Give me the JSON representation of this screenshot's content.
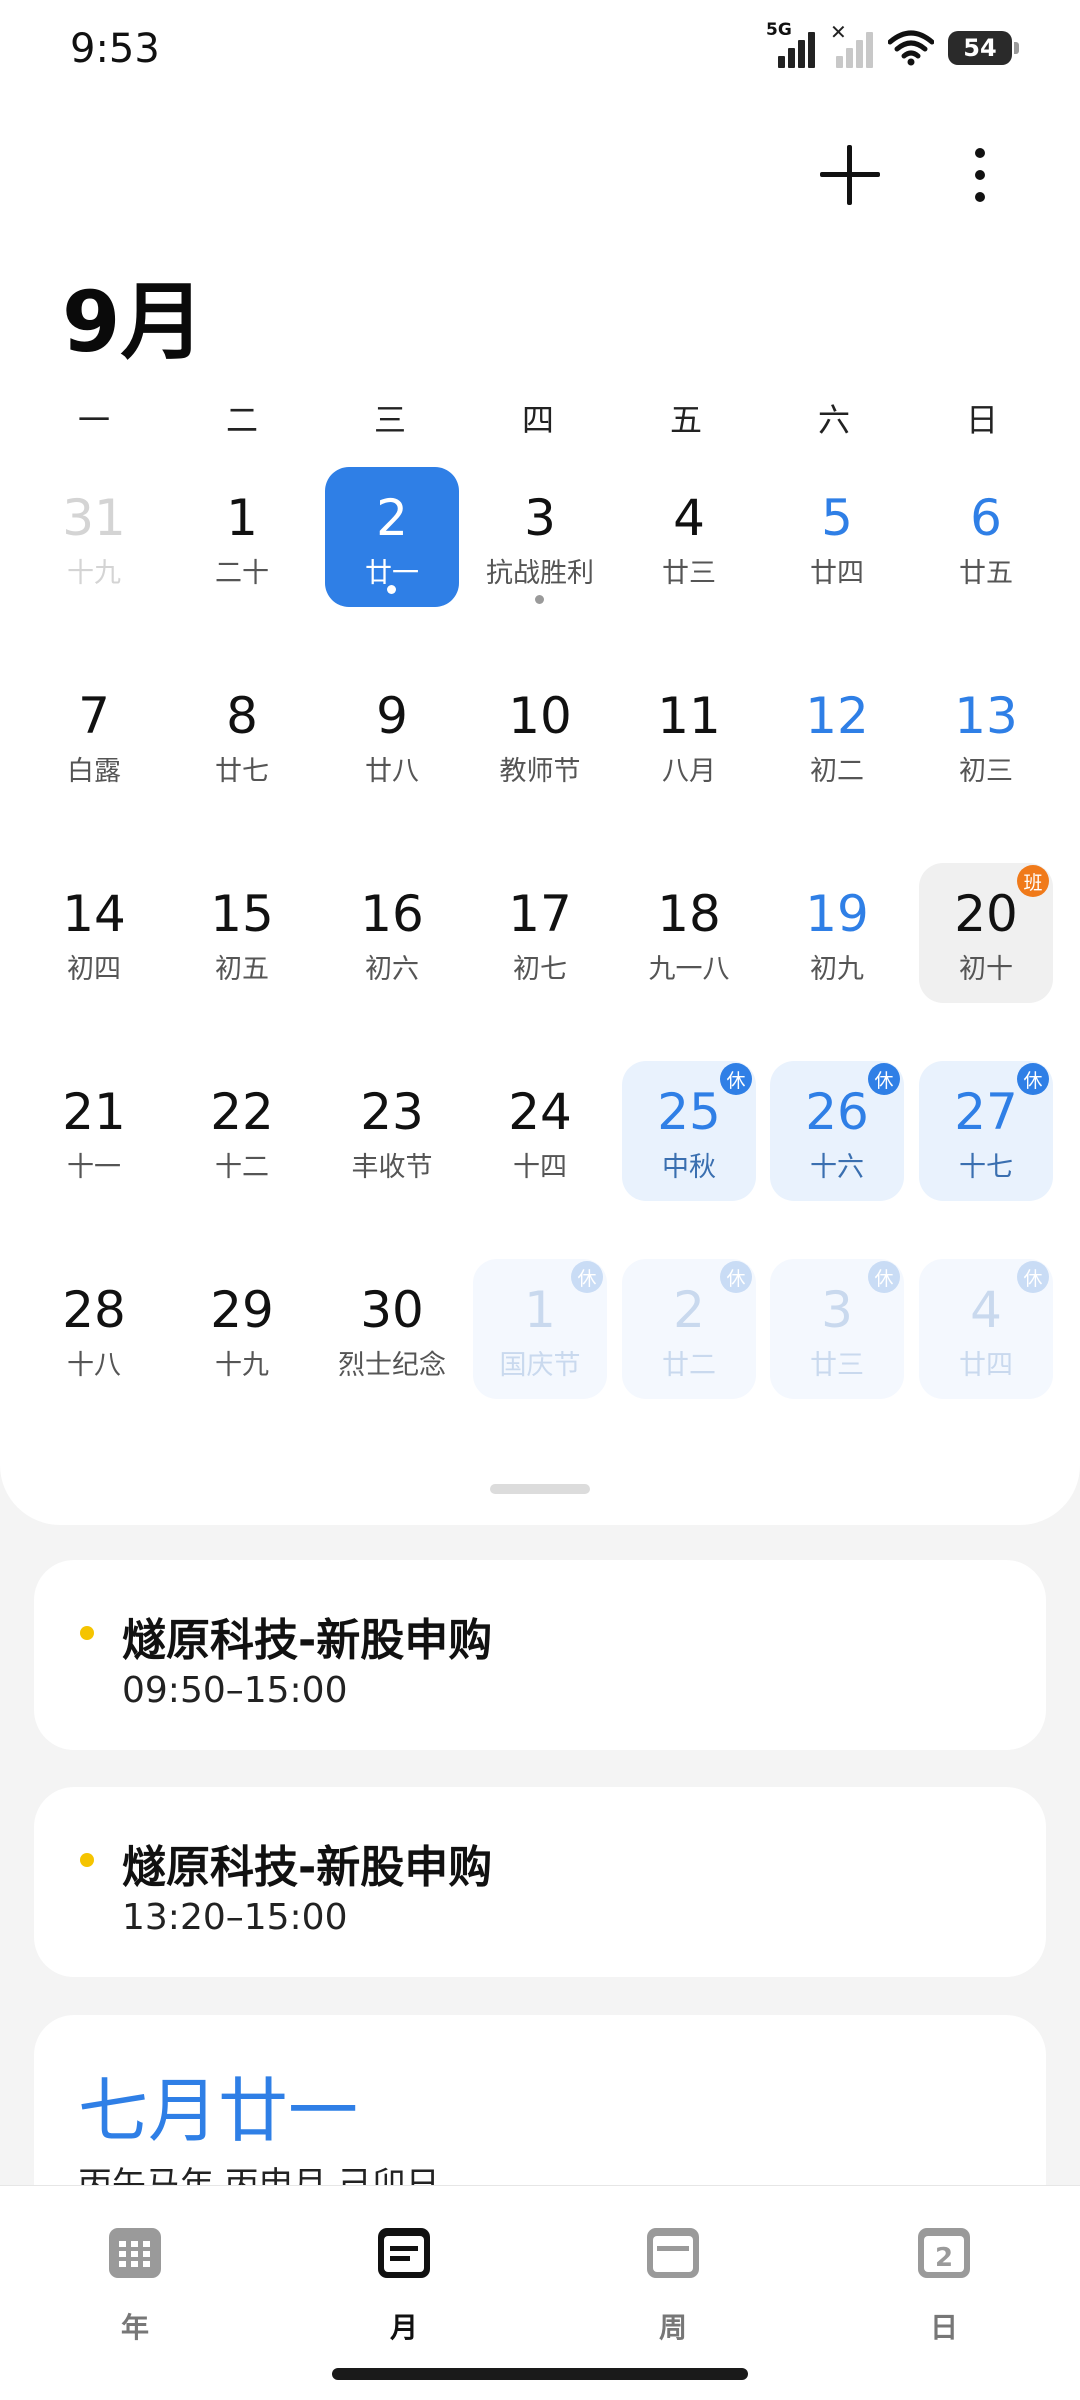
{
  "status_bar": {
    "time": "9:53",
    "network_label": "5G",
    "battery": "54"
  },
  "header": {
    "month_title": "9月",
    "add_icon": "plus-icon",
    "more_icon": "more-vertical-icon"
  },
  "weekdays": [
    "一",
    "二",
    "三",
    "四",
    "五",
    "六",
    "日"
  ],
  "days": [
    {
      "num": "31",
      "lunar": "十九",
      "faded": true
    },
    {
      "num": "1",
      "lunar": "二十"
    },
    {
      "num": "2",
      "lunar": "廿一",
      "today": true,
      "has_event": true
    },
    {
      "num": "3",
      "lunar": "抗战胜利",
      "has_event": true
    },
    {
      "num": "4",
      "lunar": "廿三"
    },
    {
      "num": "5",
      "lunar": "廿四",
      "weekend": true
    },
    {
      "num": "6",
      "lunar": "廿五",
      "weekend": true
    },
    {
      "num": "7",
      "lunar": "白露"
    },
    {
      "num": "8",
      "lunar": "廿七"
    },
    {
      "num": "9",
      "lunar": "廿八"
    },
    {
      "num": "10",
      "lunar": "教师节"
    },
    {
      "num": "11",
      "lunar": "八月"
    },
    {
      "num": "12",
      "lunar": "初二",
      "weekend": true
    },
    {
      "num": "13",
      "lunar": "初三",
      "weekend": true
    },
    {
      "num": "14",
      "lunar": "初四"
    },
    {
      "num": "15",
      "lunar": "初五"
    },
    {
      "num": "16",
      "lunar": "初六"
    },
    {
      "num": "17",
      "lunar": "初七"
    },
    {
      "num": "18",
      "lunar": "九一八"
    },
    {
      "num": "19",
      "lunar": "初九",
      "weekend": true
    },
    {
      "num": "20",
      "lunar": "初十",
      "workday": true,
      "badge": "班"
    },
    {
      "num": "21",
      "lunar": "十一"
    },
    {
      "num": "22",
      "lunar": "十二"
    },
    {
      "num": "23",
      "lunar": "丰收节"
    },
    {
      "num": "24",
      "lunar": "十四"
    },
    {
      "num": "25",
      "lunar": "中秋",
      "holiday": true,
      "badge": "休"
    },
    {
      "num": "26",
      "lunar": "十六",
      "holiday": true,
      "badge": "休"
    },
    {
      "num": "27",
      "lunar": "十七",
      "holiday": true,
      "badge": "休"
    },
    {
      "num": "28",
      "lunar": "十八"
    },
    {
      "num": "29",
      "lunar": "十九"
    },
    {
      "num": "30",
      "lunar": "烈士纪念"
    },
    {
      "num": "1",
      "lunar": "国庆节",
      "holiday": true,
      "faded": true,
      "badge": "休"
    },
    {
      "num": "2",
      "lunar": "廿二",
      "holiday": true,
      "faded": true,
      "badge": "休"
    },
    {
      "num": "3",
      "lunar": "廿三",
      "holiday": true,
      "faded": true,
      "badge": "休"
    },
    {
      "num": "4",
      "lunar": "廿四",
      "holiday": true,
      "faded": true,
      "badge": "休"
    }
  ],
  "events": [
    {
      "title": "燧原科技-新股申购",
      "time": "09:50–15:00",
      "dot_color": "#f5c400"
    },
    {
      "title": "燧原科技-新股申购",
      "time": "13:20–15:00",
      "dot_color": "#f5c400"
    }
  ],
  "lunar_info": {
    "date": "七月廿一",
    "ganzhi": "丙午马年 丙申月 己卯日"
  },
  "bottom_nav": [
    {
      "label": "年",
      "icon": "year-calendar-icon",
      "active": false
    },
    {
      "label": "月",
      "icon": "month-calendar-icon",
      "active": true
    },
    {
      "label": "周",
      "icon": "week-calendar-icon",
      "active": false
    },
    {
      "label": "日",
      "icon": "day-calendar-icon",
      "active": false,
      "icon_text": "2"
    }
  ],
  "colors": {
    "accent": "#2f7fe6",
    "workday_badge": "#f07a1a",
    "event_dot": "#f5c400"
  }
}
